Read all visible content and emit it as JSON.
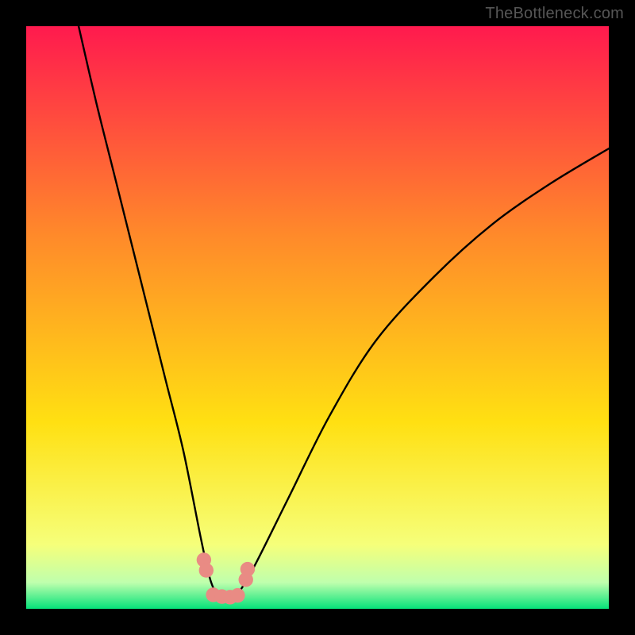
{
  "attribution": "TheBottleneck.com",
  "chart_data": {
    "type": "line",
    "title": "",
    "xlabel": "",
    "ylabel": "",
    "xlim": [
      0,
      100
    ],
    "ylim": [
      0,
      100
    ],
    "grid": false,
    "legend": false,
    "background_gradient_top": "#ff1a4e",
    "background_gradient_mid": "#ffe012",
    "background_gradient_bottom": "#06e27a",
    "curve_color": "#000000",
    "markers_color": "#e98b84",
    "series": [
      {
        "name": "curve",
        "x": [
          9,
          12,
          15,
          18,
          21,
          24,
          27,
          30,
          31.6,
          33,
          34.5,
          36,
          39,
          45,
          52,
          60,
          70,
          80,
          90,
          100
        ],
        "y": [
          100,
          87,
          75,
          63,
          51,
          39,
          27,
          12,
          5,
          2.2,
          2.0,
          2.2,
          7,
          19,
          33,
          46,
          57,
          66,
          73,
          79
        ]
      }
    ],
    "annotations": [
      {
        "type": "marker",
        "shape": "circle",
        "x": 30.5,
        "y": 8.4
      },
      {
        "type": "marker",
        "shape": "circle",
        "x": 30.9,
        "y": 6.6
      },
      {
        "type": "marker",
        "shape": "circle",
        "x": 32.1,
        "y": 2.4
      },
      {
        "type": "marker",
        "shape": "circle",
        "x": 33.6,
        "y": 2.1
      },
      {
        "type": "marker",
        "shape": "circle",
        "x": 35.0,
        "y": 2.0
      },
      {
        "type": "marker",
        "shape": "circle",
        "x": 36.3,
        "y": 2.3
      },
      {
        "type": "marker",
        "shape": "circle",
        "x": 37.7,
        "y": 5.0
      },
      {
        "type": "marker",
        "shape": "circle",
        "x": 38.0,
        "y": 6.8
      }
    ]
  }
}
